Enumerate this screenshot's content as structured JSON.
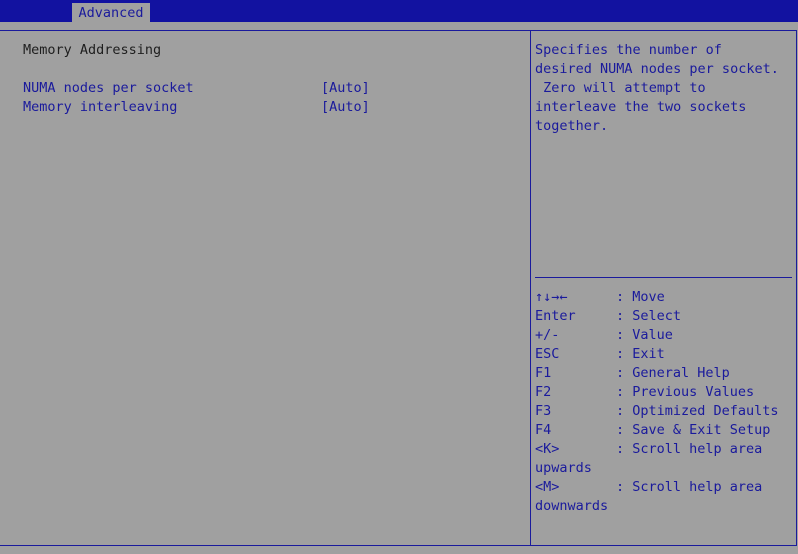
{
  "top_tab": "Advanced",
  "section_title": "Memory Addressing",
  "settings": [
    {
      "label": "NUMA nodes per socket",
      "value": "[Auto]"
    },
    {
      "label": "Memory interleaving",
      "value": "[Auto]"
    }
  ],
  "help_text": [
    "Specifies the number of",
    "desired NUMA nodes per socket.",
    " Zero will attempt to",
    "interleave the two sockets",
    "together."
  ],
  "keys": [
    {
      "key": "↑↓→←",
      "desc": ": Move"
    },
    {
      "key": "Enter",
      "desc": ": Select"
    },
    {
      "key": "+/-",
      "desc": ": Value"
    },
    {
      "key": "ESC",
      "desc": ": Exit"
    },
    {
      "key": "F1",
      "desc": ": General Help"
    },
    {
      "key": "F2",
      "desc": ": Previous Values"
    },
    {
      "key": "F3",
      "desc": ": Optimized Defaults"
    },
    {
      "key": "F4",
      "desc": ": Save & Exit Setup"
    },
    {
      "key": "<K>",
      "desc": ": Scroll help area",
      "cont": "upwards"
    },
    {
      "key": "<M>",
      "desc": ": Scroll help area",
      "cont": "downwards"
    }
  ]
}
